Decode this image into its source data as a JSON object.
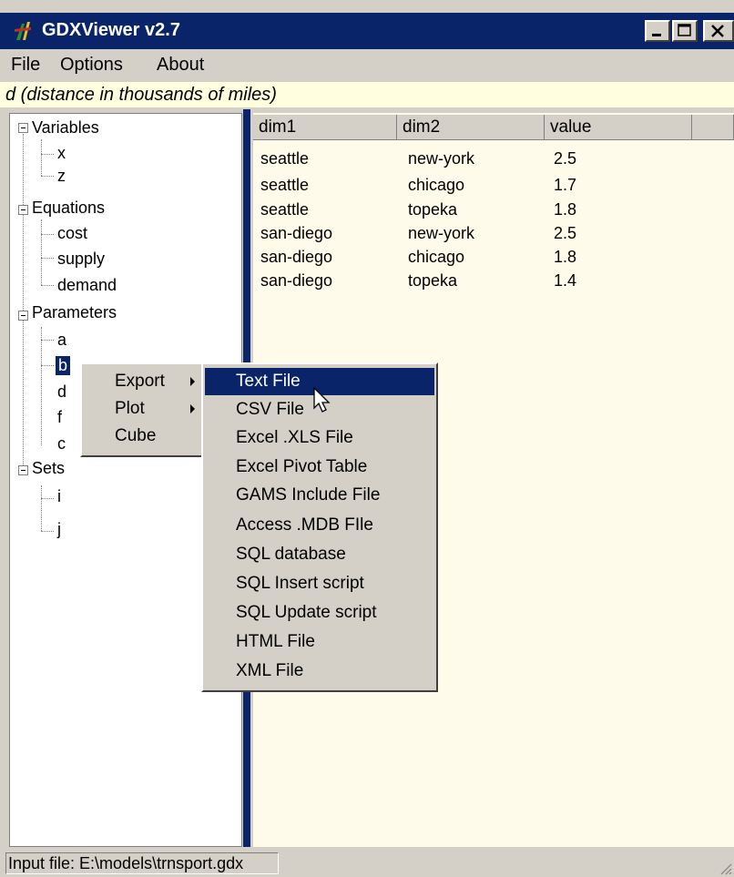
{
  "window": {
    "title": "GDXViewer v2.7"
  },
  "menubar": {
    "items": [
      "File",
      "Options",
      "About"
    ]
  },
  "caption": "d (distance in thousands of miles)",
  "tree": {
    "groups": [
      {
        "label": "Variables",
        "children": [
          "x",
          "z"
        ]
      },
      {
        "label": "Equations",
        "children": [
          "cost",
          "supply",
          "demand"
        ]
      },
      {
        "label": "Parameters",
        "children": [
          "a",
          "b",
          "d",
          "f",
          "c"
        ]
      },
      {
        "label": "Sets",
        "children": [
          "i",
          "j"
        ]
      }
    ],
    "selected": "b"
  },
  "grid": {
    "headers": [
      "dim1",
      "dim2",
      "value"
    ],
    "rows": [
      [
        "seattle",
        "new-york",
        "2.5"
      ],
      [
        "seattle",
        "chicago",
        "1.7"
      ],
      [
        "seattle",
        "topeka",
        "1.8"
      ],
      [
        "san-diego",
        "new-york",
        "2.5"
      ],
      [
        "san-diego",
        "chicago",
        "1.8"
      ],
      [
        "san-diego",
        "topeka",
        "1.4"
      ]
    ]
  },
  "context_menu": {
    "items": [
      "Export",
      "Plot",
      "Cube"
    ]
  },
  "export_submenu": {
    "items": [
      "Text File",
      "CSV File",
      "Excel .XLS File",
      "Excel Pivot Table",
      "GAMS Include File",
      "Access .MDB FIle",
      "SQL database",
      "SQL Insert script",
      "SQL Update script",
      "HTML File",
      "XML File"
    ],
    "highlighted": "Text File"
  },
  "status": {
    "text": "Input file: E:\\models\\trnsport.gdx"
  },
  "colors": {
    "titlebar": "#0a246a",
    "highlight": "#0a246a",
    "caption_bg": "#ffffe0",
    "grid_bg": "#fffbea"
  }
}
